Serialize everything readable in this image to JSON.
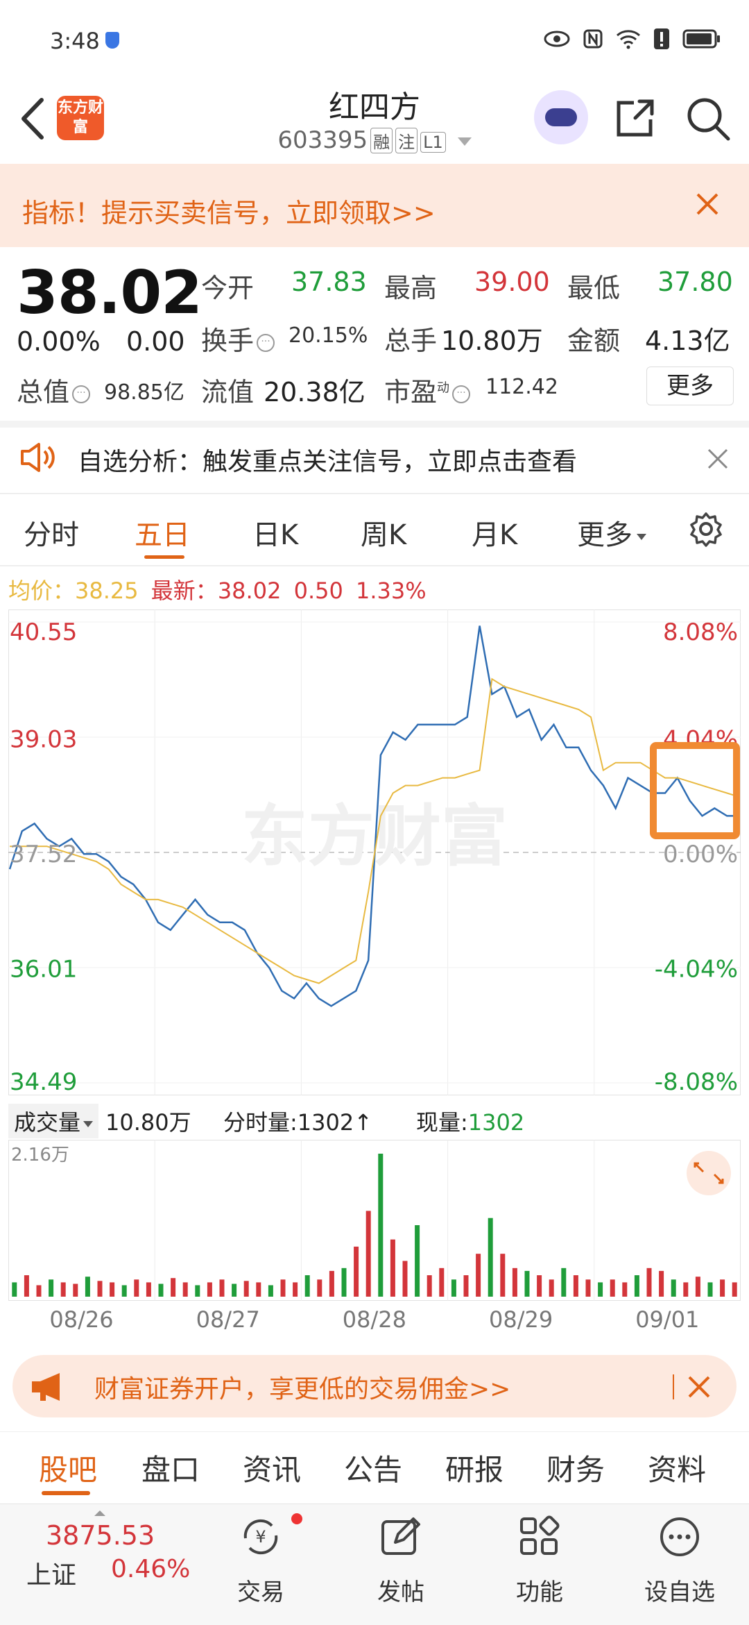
{
  "status": {
    "time": "3:48"
  },
  "header": {
    "logo_text": "东方财富",
    "name": "红四方",
    "code": "603395",
    "tags": [
      "融",
      "注",
      "L1"
    ]
  },
  "promo": {
    "text": "指标！提示买卖信号，立即领取>>"
  },
  "quote": {
    "price": "38.02",
    "change_pct": "0.00%",
    "change_val": "0.00",
    "open_label": "今开",
    "open": "37.83",
    "high_label": "最高",
    "high": "39.00",
    "low_label": "最低",
    "low": "37.80",
    "turnover_label": "换手",
    "turnover": "20.15%",
    "volume_label": "总手",
    "volume": "10.80万",
    "amount_label": "金额",
    "amount": "4.13亿",
    "mktcap_label": "总值",
    "mktcap": "98.85亿",
    "float_label": "流值",
    "float": "20.38亿",
    "pe_label": "市盈",
    "pe_sup": "动",
    "pe": "112.42",
    "more_btn": "更多"
  },
  "analysis": {
    "text": "自选分析：触发重点关注信号，立即点击查看"
  },
  "chart_tabs": [
    "分时",
    "五日",
    "日K",
    "周K",
    "月K",
    "更多"
  ],
  "chart_header": {
    "avg_label": "均价：",
    "avg": "38.25",
    "latest_label": "最新：",
    "latest": "38.02",
    "latest_chg": "0.50",
    "latest_pct": "1.33%"
  },
  "volume_header": {
    "select_label": "成交量",
    "total": "10.80万",
    "period_label": "分时量:",
    "period_val": "1302",
    "now_label": "现量:",
    "now_val": "1302",
    "max_label": "2.16万"
  },
  "watermark": "东方财富",
  "chart_data": {
    "type": "line",
    "title": "",
    "x_ticks": [
      "08/26",
      "08/27",
      "08/28",
      "08/29",
      "09/01"
    ],
    "y_left_ticks": [
      "40.55",
      "39.03",
      "37.52",
      "36.01",
      "34.49"
    ],
    "y_right_ticks": [
      "8.08%",
      "4.04%",
      "0.00%",
      "-4.04%",
      "-8.08%"
    ],
    "ylim": [
      34.49,
      40.55
    ],
    "reference_price": 37.52,
    "series": [
      {
        "name": "",
        "color": "#2f6db3",
        "values": [
          37.3,
          37.8,
          37.9,
          37.7,
          37.6,
          37.7,
          37.5,
          37.5,
          37.4,
          37.2,
          37.1,
          36.9,
          36.6,
          36.5,
          36.7,
          36.9,
          36.7,
          36.6,
          36.6,
          36.5,
          36.2,
          36.0,
          35.7,
          35.6,
          35.8,
          35.6,
          35.5,
          35.6,
          35.7,
          36.1,
          38.8,
          39.1,
          39.0,
          39.2,
          39.2,
          39.2,
          39.2,
          39.3,
          40.5,
          39.6,
          39.7,
          39.3,
          39.4,
          39.0,
          39.2,
          38.9,
          38.9,
          38.6,
          38.4,
          38.1,
          38.5,
          38.4,
          38.3,
          38.3,
          38.5,
          38.2,
          38.0,
          38.1,
          38.0,
          38.0
        ]
      },
      {
        "name": "",
        "color": "#e8b940",
        "values": [
          37.6,
          37.6,
          37.6,
          37.6,
          37.55,
          37.5,
          37.45,
          37.4,
          37.3,
          37.1,
          37.0,
          36.9,
          36.9,
          36.85,
          36.8,
          36.7,
          36.6,
          36.5,
          36.4,
          36.3,
          36.2,
          36.1,
          36.0,
          35.9,
          35.85,
          35.8,
          35.9,
          36.0,
          36.1,
          37.0,
          38.0,
          38.3,
          38.4,
          38.4,
          38.45,
          38.5,
          38.5,
          38.55,
          38.6,
          39.8,
          39.7,
          39.65,
          39.6,
          39.55,
          39.5,
          39.45,
          39.4,
          39.3,
          38.6,
          38.7,
          38.7,
          38.7,
          38.6,
          38.5,
          38.5,
          38.45,
          38.4,
          38.35,
          38.3,
          38.25
        ]
      }
    ]
  },
  "volume_data": {
    "max": "2.16万",
    "values": [
      0.1,
      0.15,
      0.08,
      0.12,
      0.1,
      0.09,
      0.14,
      0.11,
      0.1,
      0.08,
      0.12,
      0.1,
      0.09,
      0.13,
      0.1,
      0.08,
      0.1,
      0.12,
      0.09,
      0.11,
      0.1,
      0.08,
      0.12,
      0.1,
      0.15,
      0.12,
      0.18,
      0.2,
      0.35,
      0.6,
      1.0,
      0.4,
      0.25,
      0.5,
      0.15,
      0.2,
      0.12,
      0.15,
      0.3,
      0.55,
      0.3,
      0.2,
      0.18,
      0.15,
      0.12,
      0.2,
      0.15,
      0.12,
      0.1,
      0.12,
      0.1,
      0.15,
      0.2,
      0.18,
      0.12,
      0.1,
      0.14,
      0.1,
      0.12,
      0.1
    ]
  },
  "ad": {
    "text": "财富证券开户，享更低的交易佣金>>"
  },
  "bottom_tabs": [
    "股吧",
    "盘口",
    "资讯",
    "公告",
    "研报",
    "财务",
    "资料"
  ],
  "index": {
    "value": "3875.53",
    "name": "上证",
    "pct": "0.46%"
  },
  "nav": {
    "trade": "交易",
    "post": "发帖",
    "func": "功能",
    "watch": "设自选"
  }
}
